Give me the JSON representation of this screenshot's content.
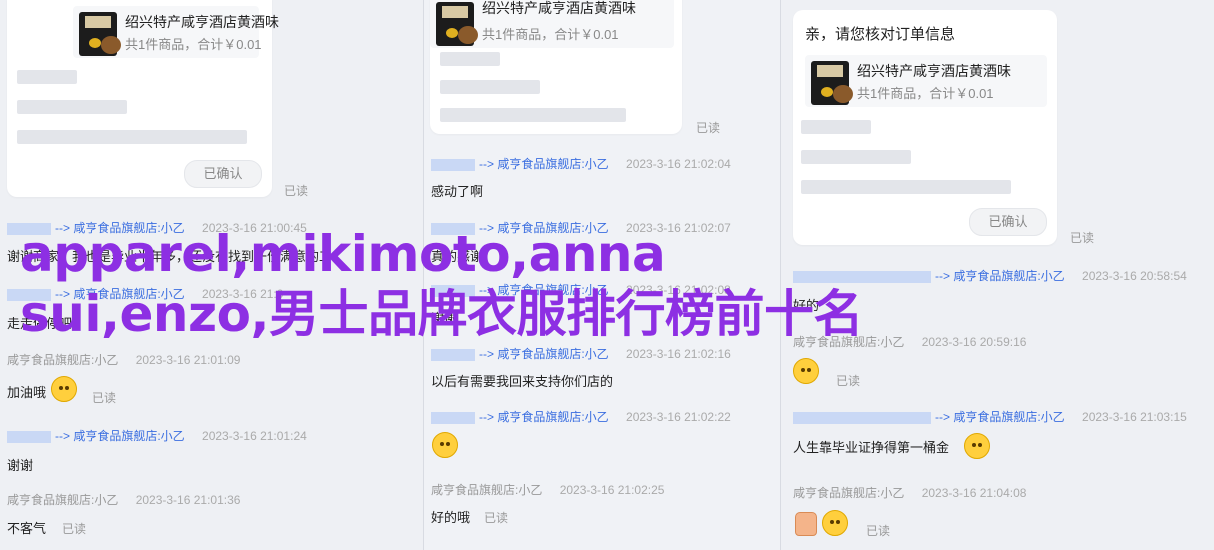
{
  "product": {
    "name": "绍兴特产咸亨酒店黄酒味",
    "meta": "共1件商品，合计￥0.01"
  },
  "order_prompt": "亲，请您核对订单信息",
  "confirmed_label": "已确认",
  "read_label": "已读",
  "arrow": "-->",
  "shop_agent": "咸亨食品旗舰店:小乙",
  "col1": {
    "m1": {
      "time": "2023-3-16 21:00:45",
      "text": "谢谢商家，我也是毕业半年多，还没有找到一份满意的工作"
    },
    "m2": {
      "time": "2023-3-16 21:0",
      "text": "走走停停吧"
    },
    "m3": {
      "time": "2023-3-16 21:01:09",
      "text": "加油哦"
    },
    "m4": {
      "time": "2023-3-16 21:01:24",
      "text": "谢谢"
    },
    "m5": {
      "time": "2023-3-16 21:01:36",
      "text": "不客气"
    }
  },
  "col2": {
    "m1": {
      "time": "2023-3-16 21:02:04",
      "text": "感动了啊"
    },
    "m2": {
      "time": "2023-3-16 21:02:07",
      "text": "真的感谢"
    },
    "m3": {
      "time": "2023-3-16 21:02:08",
      "text": "谢谢"
    },
    "m4": {
      "time": "2023-3-16 21:02:16",
      "text": "以后有需要我回来支持你们店的"
    },
    "m5": {
      "time": "2023-3-16 21:02:22"
    },
    "m6": {
      "time": "2023-3-16 21:02:25",
      "text": "好的哦"
    }
  },
  "col3": {
    "m1": {
      "time": "2023-3-16 20:58:54",
      "text": "好的"
    },
    "m2": {
      "time": "2023-3-16 20:59:16"
    },
    "m3": {
      "time": "2023-3-16 21:03:15",
      "text": "人生靠毕业证挣得第一桶金"
    },
    "m4": {
      "time": "2023-3-16 21:04:08"
    }
  },
  "overlay": {
    "line1": "apparel,mikimoto,anna",
    "line2": "sui,enzo,男士品牌衣服排行榜前十名"
  },
  "colors": {
    "link": "#3b6ee0",
    "overlay": "#8d2fe3",
    "background": "#eef0f4"
  },
  "emoji_icons": [
    "smile-emoji-icon",
    "pleading-emoji-icon",
    "thinking-emoji-icon",
    "tears-emoji-icon",
    "thumbs-up-icon"
  ]
}
